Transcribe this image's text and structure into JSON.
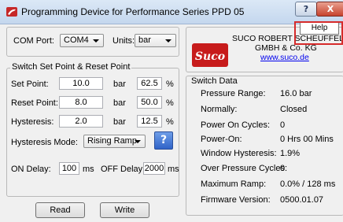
{
  "window": {
    "title": "Programming Device for Performance Series PPD 05",
    "help_button": "?",
    "close_button": "X",
    "tooltip": "Help"
  },
  "com": {
    "label": "COM Port:",
    "value": "COM4"
  },
  "units": {
    "label": "Units:",
    "value": "bar"
  },
  "switch_group": {
    "title": "Switch Set Point & Reset Point",
    "set_point": {
      "label": "Set Point:",
      "value": "10.0",
      "unit": "bar",
      "percent": "62.5",
      "pct_sign": "%"
    },
    "reset_point": {
      "label": "Reset Point:",
      "value": "8.0",
      "unit": "bar",
      "percent": "50.0",
      "pct_sign": "%"
    },
    "hysteresis": {
      "label": "Hysteresis:",
      "value": "2.0",
      "unit": "bar",
      "percent": "12.5",
      "pct_sign": "%"
    },
    "hysteresis_mode": {
      "label": "Hysteresis Mode:",
      "value": "Rising Ramp"
    },
    "help": "?"
  },
  "delay": {
    "on_label": "ON Delay:",
    "on_value": "100",
    "on_unit": "ms",
    "off_label": "OFF Delay:",
    "off_value": "2000",
    "off_unit": "ms"
  },
  "buttons": {
    "read": "Read",
    "write": "Write"
  },
  "company": {
    "logo_text": "Suco",
    "name_line1": "SUCO ROBERT SCHEUFFELE",
    "name_line2": "GMBH & Co. KG",
    "url": "www.suco.de"
  },
  "switch_data": {
    "title": "Switch Data",
    "rows": [
      {
        "label": "Pressure Range:",
        "value": "16.0 bar"
      },
      {
        "label": "Normally:",
        "value": "Closed"
      },
      {
        "label": "Power On Cycles:",
        "value": "0"
      },
      {
        "label": "Power-On:",
        "value": "0 Hrs 00 Mins"
      },
      {
        "label": "Window Hysteresis:",
        "value": "1.9%"
      },
      {
        "label": "Over Pressure Cycles:",
        "value": "0"
      },
      {
        "label": "Maximum Ramp:",
        "value": "0.0% / 128 ms"
      },
      {
        "label": "Firmware Version:",
        "value": "0500.01.07"
      }
    ]
  }
}
